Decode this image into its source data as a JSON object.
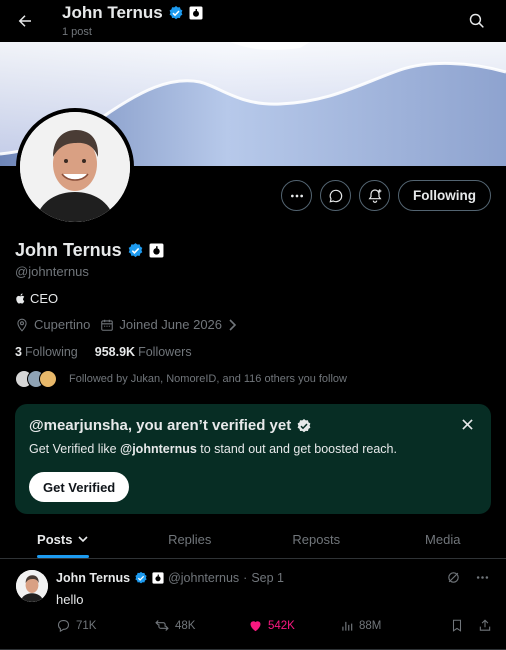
{
  "header": {
    "name": "John Ternus",
    "post_count": "1 post",
    "icons": [
      "back-arrow-icon",
      "verified-badge-icon",
      "affiliate-badge-icon",
      "search-icon"
    ]
  },
  "profile": {
    "name": "John Ternus",
    "handle": "@johnternus",
    "bio": "CEO",
    "location": "Cupertino",
    "joined": "Joined June 2026",
    "following_count": "3",
    "following_label": "Following",
    "followers_count": "958.9K",
    "followers_label": "Followers",
    "followed_by": "Followed by Jukan, NomoreID, and 116 others you follow"
  },
  "actions": {
    "following_button": "Following",
    "icons": [
      "more-icon",
      "message-icon",
      "notifications-icon"
    ]
  },
  "verify_card": {
    "title": "@mearjunsha, you aren’t verified yet",
    "text_prefix": "Get Verified like ",
    "text_handle": "@johnternus",
    "text_suffix": " to stand out and get boosted reach.",
    "button": "Get Verified"
  },
  "tabs": [
    {
      "label": "Posts",
      "active": true
    },
    {
      "label": "Replies",
      "active": false
    },
    {
      "label": "Reposts",
      "active": false
    },
    {
      "label": "Media",
      "active": false
    }
  ],
  "post": {
    "name": "John Ternus",
    "handle": "@johnternus",
    "separator": "·",
    "time": "Sep 1",
    "text": "hello",
    "replies": "71K",
    "reposts": "48K",
    "likes": "542K",
    "views": "88M"
  },
  "colors": {
    "accent": "#1d9bf0",
    "like": "#f91880",
    "card_bg": "#072d24",
    "muted": "#71767b"
  }
}
